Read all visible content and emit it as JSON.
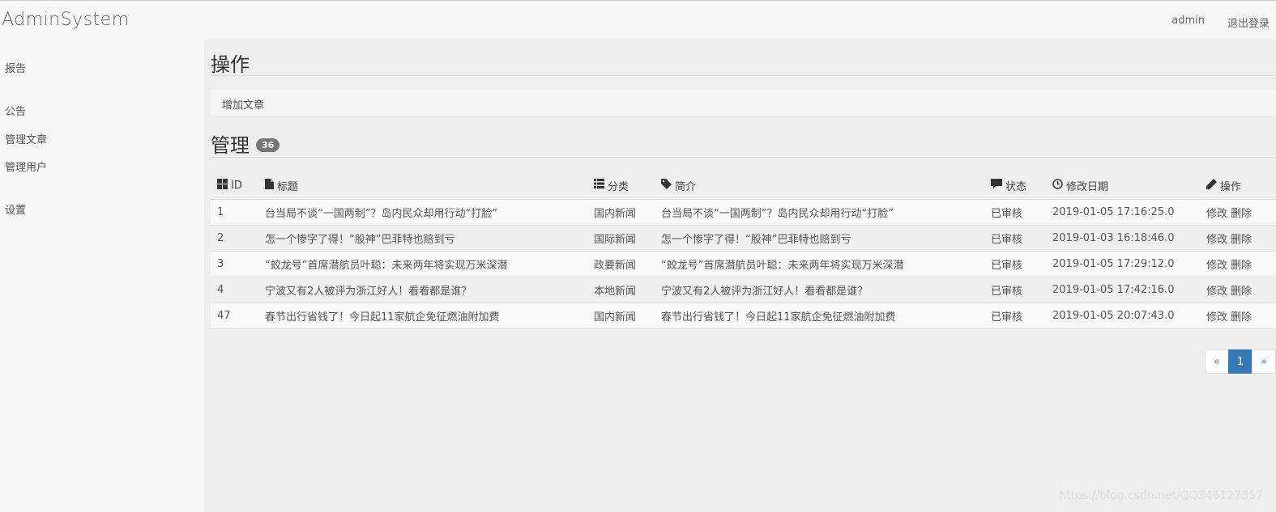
{
  "header": {
    "brand": "AdminSystem",
    "user": "admin",
    "logout": "退出登录"
  },
  "sidebar": {
    "items": [
      {
        "label": "报告"
      },
      {
        "label": "公告"
      },
      {
        "label": "管理文章"
      },
      {
        "label": "管理用户"
      },
      {
        "label": "设置"
      }
    ]
  },
  "operations": {
    "heading": "操作",
    "add_article": "增加文章"
  },
  "manage": {
    "heading": "管理",
    "count": "36"
  },
  "table": {
    "columns": [
      {
        "label": "ID",
        "icon": "grid-icon"
      },
      {
        "label": "标题",
        "icon": "file-icon"
      },
      {
        "label": "分类",
        "icon": "list-icon"
      },
      {
        "label": "简介",
        "icon": "tag-icon"
      },
      {
        "label": "状态",
        "icon": "comment-icon"
      },
      {
        "label": "修改日期",
        "icon": "clock-icon"
      },
      {
        "label": "操作",
        "icon": "pencil-icon"
      }
    ],
    "rows": [
      {
        "id": "1",
        "title": "台当局不谈“一国两制”？岛内民众却用行动“打脸”",
        "category": "国内新闻",
        "desc": "台当局不谈“一国两制”？岛内民众却用行动“打脸”",
        "status": "已审核",
        "date": "2019-01-05 17:16:25.0",
        "edit": "修改",
        "delete": "删除"
      },
      {
        "id": "2",
        "title": "怎一个惨字了得！“股神”巴菲特也赔到亏",
        "category": "国际新闻",
        "desc": "怎一个惨字了得！“股神”巴菲特也赔到亏",
        "status": "已审核",
        "date": "2019-01-03 16:18:46.0",
        "edit": "修改",
        "delete": "删除"
      },
      {
        "id": "3",
        "title": "“蛟龙号”首席潜航员叶聪：未来两年将实现万米深潜",
        "category": "政要新闻",
        "desc": "“蛟龙号”首席潜航员叶聪：未来两年将实现万米深潜",
        "status": "已审核",
        "date": "2019-01-05 17:29:12.0",
        "edit": "修改",
        "delete": "删除"
      },
      {
        "id": "4",
        "title": "宁波又有2人被评为浙江好人！看看都是谁？",
        "category": "本地新闻",
        "desc": "宁波又有2人被评为浙江好人！看看都是谁？",
        "status": "已审核",
        "date": "2019-01-05 17:42:16.0",
        "edit": "修改",
        "delete": "删除"
      },
      {
        "id": "47",
        "title": "春节出行省钱了！今日起11家航企免征燃油附加费",
        "category": "国内新闻",
        "desc": "春节出行省钱了！今日起11家航企免征燃油附加费",
        "status": "已审核",
        "date": "2019-01-05 20:07:43.0",
        "edit": "修改",
        "delete": "删除"
      }
    ]
  },
  "pagination": {
    "prev": "«",
    "current": "1",
    "next": "»"
  },
  "watermark": "https://blog.csdn.net/QQ346127357",
  "colors": {
    "accent": "#337ab7",
    "badge": "#777777",
    "main_bg": "#eeeeee",
    "sidebar_bg": "#f8f8f8"
  }
}
